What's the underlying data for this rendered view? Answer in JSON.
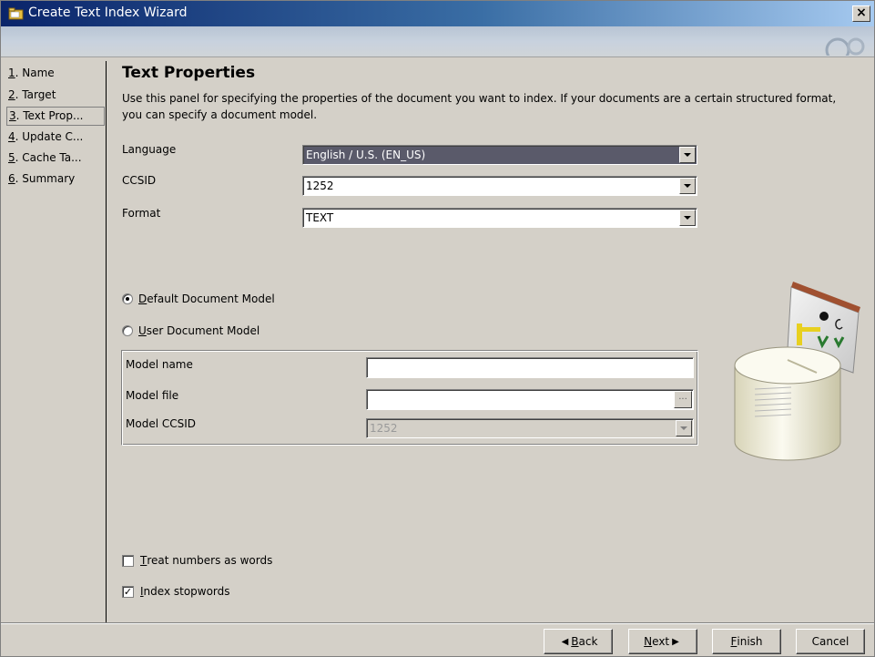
{
  "window": {
    "title": "Create Text Index Wizard",
    "close_label": "×"
  },
  "nav": {
    "items": [
      {
        "num": "1",
        "rest": ". Name"
      },
      {
        "num": "2",
        "rest": ". Target"
      },
      {
        "num": "3",
        "rest": ". Text Prop..."
      },
      {
        "num": "4",
        "rest": ". Update C..."
      },
      {
        "num": "5",
        "rest": ". Cache Ta..."
      },
      {
        "num": "6",
        "rest": ". Summary"
      }
    ],
    "selected_index": 2
  },
  "panel": {
    "title": "Text Properties",
    "description": "Use this panel for specifying the properties of the document you want to index. If your documents are a certain structured format, you can specify a document model."
  },
  "fields": {
    "language_label": "Language",
    "language_value": "English / U.S. (EN_US)",
    "ccsid_label": "CCSID",
    "ccsid_value": "1252",
    "format_label": "Format",
    "format_value": "TEXT"
  },
  "model": {
    "default_label_mnemonic": "D",
    "default_label_rest": "efault Document Model",
    "default_selected": true,
    "user_label_mnemonic": "U",
    "user_label_rest": "ser Document Model",
    "name_label": "Model name",
    "name_value": "",
    "file_label": "Model file",
    "file_value": "",
    "browse_label": "...",
    "ccsid_label": "Model CCSID",
    "ccsid_value": "1252"
  },
  "options": {
    "treat_numbers_mnemonic": "T",
    "treat_numbers_rest": "reat numbers as words",
    "treat_numbers_checked": false,
    "index_stopwords_mnemonic": "I",
    "index_stopwords_rest": "ndex stopwords",
    "index_stopwords_checked": true,
    "check_mark": "✓"
  },
  "buttons": {
    "back_mnemonic": "B",
    "back_rest": "ack",
    "next_mnemonic": "N",
    "next_rest": "ext",
    "finish_mnemonic": "F",
    "finish_rest": "inish",
    "cancel_label": "Cancel"
  },
  "icons": {
    "title": "wizard-folder-icon",
    "illustration": "database-index-illustration"
  }
}
